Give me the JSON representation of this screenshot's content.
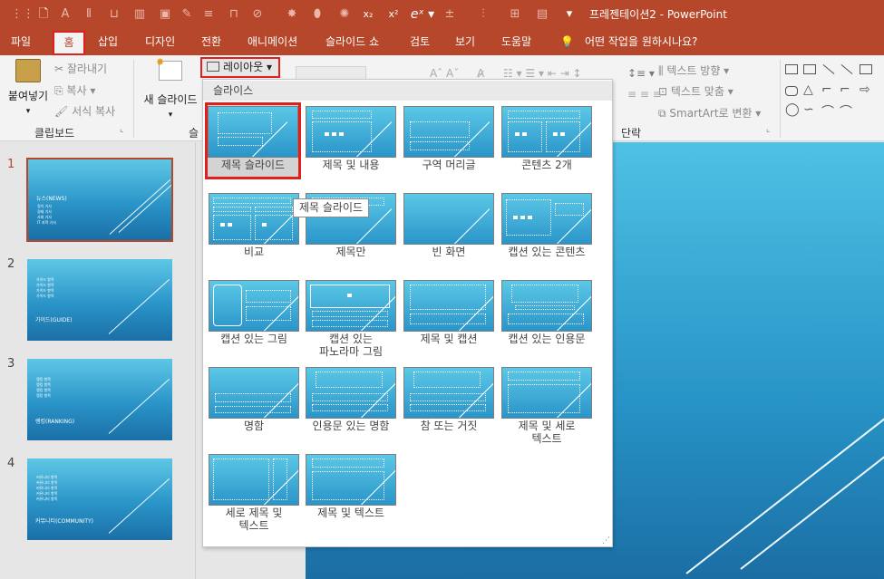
{
  "window": {
    "title": "프레젠테이션2 - PowerPoint"
  },
  "tabs": [
    "파일",
    "홈",
    "삽입",
    "디자인",
    "전환",
    "애니메이션",
    "슬라이드 쇼",
    "검토",
    "보기",
    "도움말"
  ],
  "tell_me": "어떤 작업을 원하시나요?",
  "clipboard": {
    "paste": "붙여넣기",
    "cut": "잘라내기",
    "copy": "복사",
    "format_painter": "서식 복사",
    "group": "클립보드"
  },
  "slides_group": {
    "new_slide": "새 슬라이드",
    "group_partial": "슬",
    "layout_btn": "레이아웃"
  },
  "paragraph": {
    "text_direction": "텍스트 방향",
    "align_text": "텍스트 맞춤",
    "smartart": "SmartArt로 변환",
    "group": "단락"
  },
  "layout_menu": {
    "header": "슬라이스",
    "items": [
      "제목 슬라이드",
      "제목 및 내용",
      "구역 머리글",
      "콘텐츠 2개",
      "비교",
      "제목만",
      "빈 화면",
      "캡션 있는 콘텐츠",
      "캡션 있는 그림",
      "캡션 있는\n파노라마 그림",
      "제목 및 캡션",
      "캡션 있는 인용문",
      "명함",
      "인용문 있는 명함",
      "참 또는 거짓",
      "제목 및 세로\n텍스트",
      "세로 제목 및\n텍스트",
      "제목 및 텍스트"
    ],
    "selected_index": 0,
    "tooltip": "제목 슬라이드"
  },
  "slides": [
    {
      "number": "1",
      "title": "뉴스(NEWS)",
      "bullets": [
        "정치 기사",
        "경제 기사",
        "사회 기사",
        "IT 과학 기사"
      ]
    },
    {
      "number": "2",
      "title": "가이드(GUIDE)",
      "bullets": [
        "가이드 항목",
        "가이드 항목",
        "가이드 항목",
        "가이드 항목"
      ]
    },
    {
      "number": "3",
      "title": "랭킹(RANKING)",
      "bullets": [
        "랭킹 항목",
        "랭킹 항목",
        "랭킹 항목",
        "랭킹 항목"
      ]
    },
    {
      "number": "4",
      "title": "커뮤니티(COMMUNITY)",
      "bullets": [
        "커뮤니티 항목",
        "커뮤니티 항목",
        "커뮤니티 항목",
        "커뮤니티 항목",
        "커뮤니티 항목"
      ]
    }
  ],
  "colors": {
    "accent": "#b7472a",
    "highlight": "#e0201e"
  }
}
